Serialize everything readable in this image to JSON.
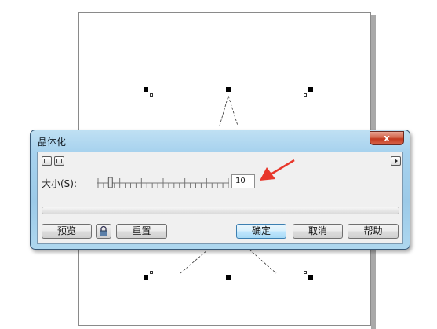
{
  "dialog": {
    "title": "晶体化",
    "close_label": "x",
    "size_label": "大小(S):",
    "size_value": "10",
    "slider_fraction": 0.1,
    "buttons": {
      "preview": "预览",
      "reset": "重置",
      "ok": "确定",
      "cancel": "取消",
      "help": "帮助"
    }
  },
  "colors": {
    "arrow": "#e8372b",
    "window_frame": "#a7d2ee",
    "close_button": "#c3391f"
  },
  "icons": [
    "view-mode-icon",
    "view-mode-icon",
    "play-icon",
    "lock-icon",
    "close-icon"
  ]
}
